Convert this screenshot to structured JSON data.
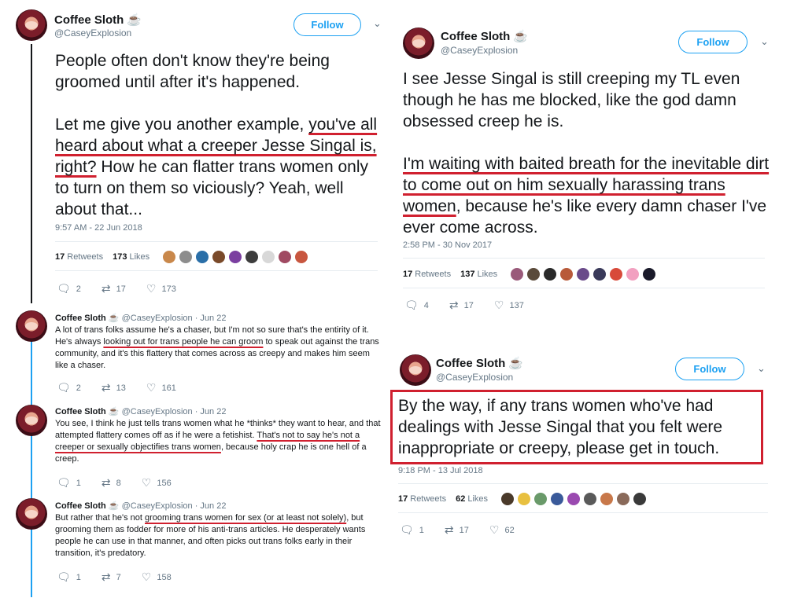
{
  "left": {
    "main": {
      "name": "Coffee Sloth",
      "cup": "☕",
      "handle": "@CaseyExplosion",
      "follow": "Follow",
      "para1": "People often don't know they're being groomed until after it's happened.",
      "para2_a": "Let me give you another example, ",
      "para2_u": "you've all heard about what a creeper Jesse Singal is, right?",
      "para2_b": " How he can flatter trans women only to turn on them so viciously? Yeah, well about that...",
      "timestamp": "9:57 AM - 22 Jun 2018",
      "retweets_num": "17",
      "retweets_label": "Retweets",
      "likes_num": "173",
      "likes_label": "Likes",
      "replies": "2",
      "rts": "17",
      "likes": "173"
    },
    "replies": [
      {
        "name": "Coffee Sloth",
        "cup": "☕",
        "meta": "@CaseyExplosion · Jun 22",
        "body_a": "A lot of trans folks assume he's a chaser, but I'm not so sure that's the entirity of it. He's always ",
        "body_u": "looking out for trans people he can groom",
        "body_b": " to speak out against the trans community, and it's this flattery that comes across as creepy and makes him seem like a chaser.",
        "replies": "2",
        "rts": "13",
        "likes": "161"
      },
      {
        "name": "Coffee Sloth",
        "cup": "☕",
        "meta": "@CaseyExplosion · Jun 22",
        "body_a": "You see, I think he just tells trans women what he *thinks* they want to hear, and that attempted flattery comes off as if he were a fetishist. ",
        "body_u": "That's not to say he's not a creeper or sexually objectifies trans women",
        "body_b": ", because holy crap he is one hell of a creep.",
        "replies": "1",
        "rts": "8",
        "likes": "156"
      },
      {
        "name": "Coffee Sloth",
        "cup": "☕",
        "meta": "@CaseyExplosion · Jun 22",
        "body_a": "But rather that he's not ",
        "body_u": "grooming trans women for sex (or at least not solely)",
        "body_b": ", but grooming them as fodder for more of his anti-trans articles. He desperately wants people he can use in that manner, and often picks out trans folks early in their transition, it's predatory.",
        "replies": "1",
        "rts": "7",
        "likes": "158"
      }
    ]
  },
  "right_top": {
    "name": "Coffee Sloth",
    "cup": "☕",
    "handle": "@CaseyExplosion",
    "follow": "Follow",
    "para1": "I see Jesse Singal is still creeping my TL even though he has me blocked, like the god damn obsessed creep he is.",
    "para2_a": "I'm waiting with baited breath for the inevitable dirt to come out on him sexually harassing trans women",
    "para2_b": ", because he's like every damn chaser I've ever come across.",
    "timestamp": "2:58 PM - 30 Nov 2017",
    "retweets_num": "17",
    "retweets_label": "Retweets",
    "likes_num": "137",
    "likes_label": "Likes",
    "replies": "4",
    "rts": "17",
    "likes": "137"
  },
  "right_bottom": {
    "name": "Coffee Sloth",
    "cup": "☕",
    "handle": "@CaseyExplosion",
    "follow": "Follow",
    "text": "By the way, if any trans women who've had dealings with Jesse Singal that you felt were inappropriate or creepy, please get in touch.",
    "timestamp": "9:18 PM - 13 Jul 2018",
    "retweets_num": "17",
    "retweets_label": "Retweets",
    "likes_num": "62",
    "likes_label": "Likes",
    "replies": "1",
    "rts": "17",
    "likes": "62"
  },
  "icons": {
    "reply": "reply-icon",
    "retweet": "retweet-icon",
    "like": "heart-icon",
    "chevron": "chevron-down-icon"
  },
  "colors": {
    "accent": "#1da1f2",
    "annotation_red": "#d0202f"
  }
}
